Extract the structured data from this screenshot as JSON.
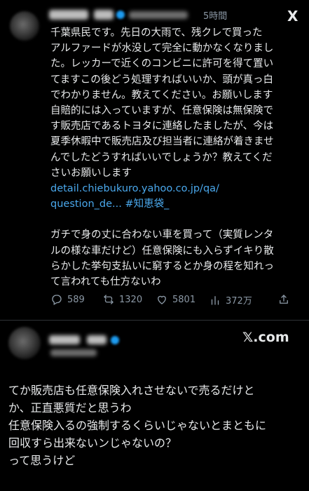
{
  "post": {
    "time": "5時間",
    "brand": "X",
    "body_lines": [
      "千葉県民です。先日の大雨で、残クレで買った",
      "アルファードが水没して完全に動かなくなりまし",
      "た。レッカーで近くのコンビニに許可を得て置い",
      "てますこの後どう処理すればいいか、頭が真っ白",
      "でわかりません。教えてください。お願いします",
      "自賠的には入っていますが、任意保険は無保険で",
      "す販売店であるトヨタに連絡したましたが、今は",
      "夏季休暇中で販売店及び担当者に連絡が着きませ",
      "んでしたどうすればいいでしょうか？教えてくだ",
      "さいお願いします"
    ],
    "link_lines": [
      "detail.chiebukuro.yahoo.co.jp/qa/",
      "question_de... #知恵袋_"
    ],
    "comment_lines": [
      "ガチで身の丈に合わない車を買って（実質レンタ",
      "ルの様な車だけど）任意保険にも入らずイキり散",
      "らかした挙句支払いに窮するとか身の程を知れっ",
      "て言われても仕方ないわ"
    ],
    "stats": {
      "replies": "589",
      "reposts": "1320",
      "likes": "5801",
      "views": "372万"
    }
  },
  "reply_header": {
    "brand": "𝕏.com"
  },
  "reply": {
    "lines": [
      "てか販売店も任意保険入れさせないで売るだけと",
      "か、正直悪質だと思うわ",
      "任意保険入るの強制するくらいじゃないとまともに",
      "回収すら出来ないンじゃないの？",
      "って思うけど"
    ]
  },
  "colors": {
    "background": "#000000",
    "text": "#e7e9ea",
    "muted": "#8b98a5",
    "link": "#4aa8ec",
    "verified": "#1d9bf0"
  }
}
